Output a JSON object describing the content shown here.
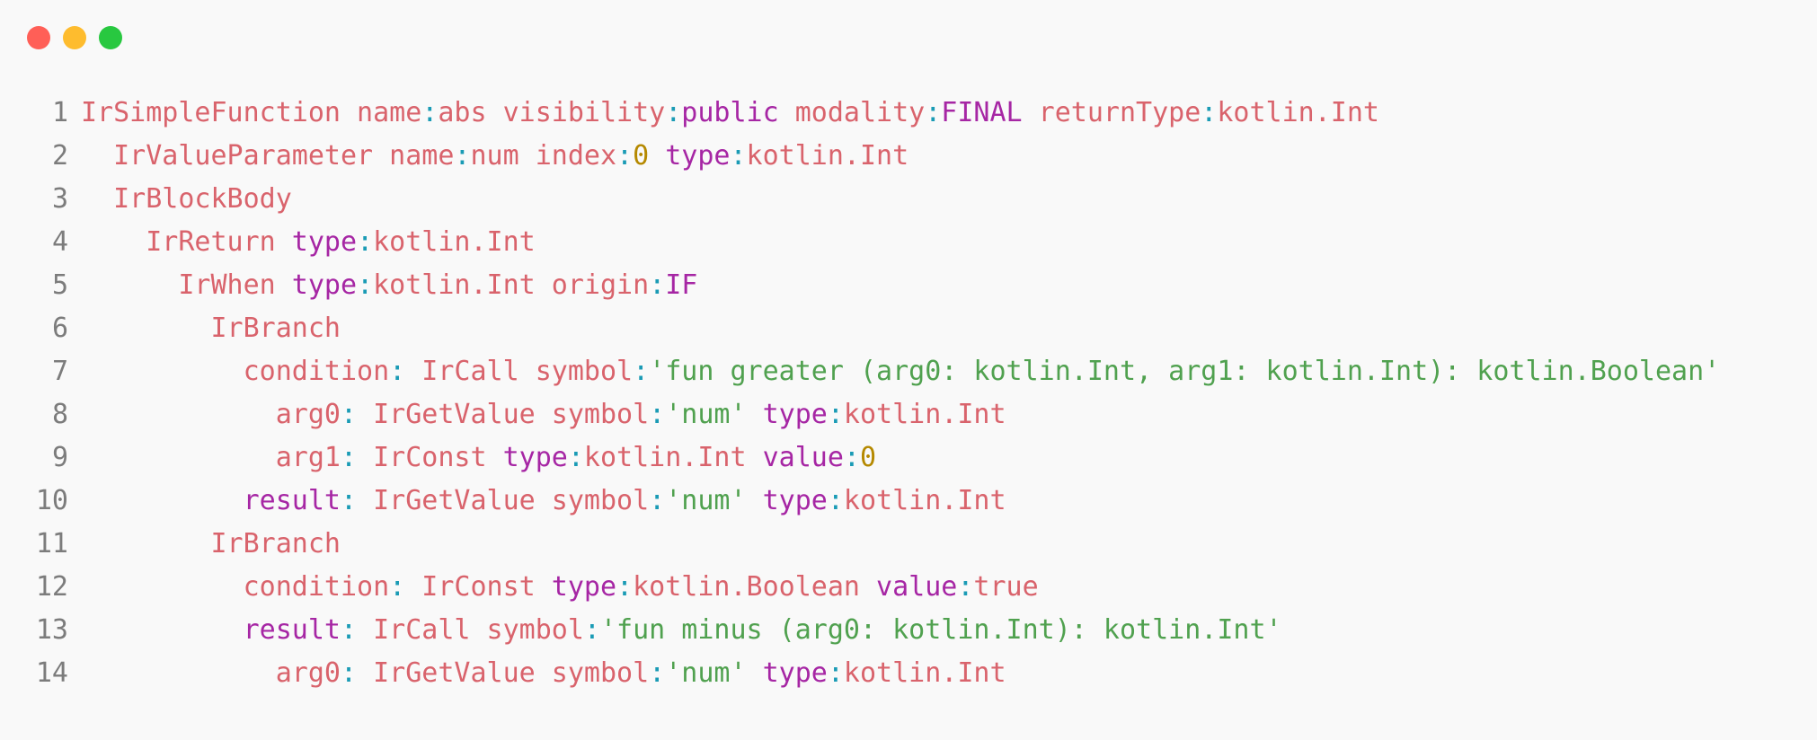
{
  "window": {
    "controls": [
      {
        "name": "close",
        "color": "#ff5f57"
      },
      {
        "name": "minimize",
        "color": "#febc2e"
      },
      {
        "name": "zoom",
        "color": "#28c840"
      }
    ]
  },
  "colors": {
    "node": "#d9636c",
    "key": "#d9636c",
    "colon": "#1a9bb5",
    "keyword": "#a626a4",
    "string": "#50a14f",
    "number": "#b58900",
    "text": "#d9636c",
    "lineno": "#7c7c7c"
  },
  "lines": [
    {
      "n": "1",
      "tokens": [
        {
          "t": "IrSimpleFunction",
          "c": "node"
        },
        {
          "t": " name",
          "c": "key"
        },
        {
          "t": ":",
          "c": "colon"
        },
        {
          "t": "abs",
          "c": "node"
        },
        {
          "t": " visibility",
          "c": "key"
        },
        {
          "t": ":",
          "c": "colon"
        },
        {
          "t": "public",
          "c": "keyword"
        },
        {
          "t": " modality",
          "c": "key"
        },
        {
          "t": ":",
          "c": "colon"
        },
        {
          "t": "FINAL",
          "c": "keyword"
        },
        {
          "t": " returnType",
          "c": "key"
        },
        {
          "t": ":",
          "c": "colon"
        },
        {
          "t": "kotlin.Int",
          "c": "node"
        }
      ]
    },
    {
      "n": "2",
      "tokens": [
        {
          "t": "  IrValueParameter",
          "c": "node"
        },
        {
          "t": " name",
          "c": "key"
        },
        {
          "t": ":",
          "c": "colon"
        },
        {
          "t": "num",
          "c": "node"
        },
        {
          "t": " index",
          "c": "key"
        },
        {
          "t": ":",
          "c": "colon"
        },
        {
          "t": "0",
          "c": "number"
        },
        {
          "t": " type",
          "c": "keyword"
        },
        {
          "t": ":",
          "c": "colon"
        },
        {
          "t": "kotlin.Int",
          "c": "node"
        }
      ]
    },
    {
      "n": "3",
      "tokens": [
        {
          "t": "  IrBlockBody",
          "c": "node"
        }
      ]
    },
    {
      "n": "4",
      "tokens": [
        {
          "t": "    IrReturn",
          "c": "node"
        },
        {
          "t": " type",
          "c": "keyword"
        },
        {
          "t": ":",
          "c": "colon"
        },
        {
          "t": "kotlin.Int",
          "c": "node"
        }
      ]
    },
    {
      "n": "5",
      "tokens": [
        {
          "t": "      IrWhen",
          "c": "node"
        },
        {
          "t": " type",
          "c": "keyword"
        },
        {
          "t": ":",
          "c": "colon"
        },
        {
          "t": "kotlin.Int",
          "c": "node"
        },
        {
          "t": " origin",
          "c": "key"
        },
        {
          "t": ":",
          "c": "colon"
        },
        {
          "t": "IF",
          "c": "keyword"
        }
      ]
    },
    {
      "n": "6",
      "tokens": [
        {
          "t": "        IrBranch",
          "c": "node"
        }
      ]
    },
    {
      "n": "7",
      "tokens": [
        {
          "t": "          condition",
          "c": "key"
        },
        {
          "t": ":",
          "c": "colon"
        },
        {
          "t": " IrCall",
          "c": "node"
        },
        {
          "t": " symbol",
          "c": "key"
        },
        {
          "t": ":",
          "c": "colon"
        },
        {
          "t": "'fun greater (arg0: kotlin.Int, arg1: kotlin.Int): kotlin.Boolean'",
          "c": "string"
        }
      ]
    },
    {
      "n": "8",
      "tokens": [
        {
          "t": "            arg0",
          "c": "key"
        },
        {
          "t": ":",
          "c": "colon"
        },
        {
          "t": " IrGetValue",
          "c": "node"
        },
        {
          "t": " symbol",
          "c": "key"
        },
        {
          "t": ":",
          "c": "colon"
        },
        {
          "t": "'num'",
          "c": "string"
        },
        {
          "t": " type",
          "c": "keyword"
        },
        {
          "t": ":",
          "c": "colon"
        },
        {
          "t": "kotlin.Int",
          "c": "node"
        }
      ]
    },
    {
      "n": "9",
      "tokens": [
        {
          "t": "            arg1",
          "c": "key"
        },
        {
          "t": ":",
          "c": "colon"
        },
        {
          "t": " IrConst",
          "c": "node"
        },
        {
          "t": " type",
          "c": "keyword"
        },
        {
          "t": ":",
          "c": "colon"
        },
        {
          "t": "kotlin.Int",
          "c": "node"
        },
        {
          "t": " value",
          "c": "keyword"
        },
        {
          "t": ":",
          "c": "colon"
        },
        {
          "t": "0",
          "c": "number"
        }
      ]
    },
    {
      "n": "10",
      "tokens": [
        {
          "t": "          result",
          "c": "keyword"
        },
        {
          "t": ":",
          "c": "colon"
        },
        {
          "t": " IrGetValue",
          "c": "node"
        },
        {
          "t": " symbol",
          "c": "key"
        },
        {
          "t": ":",
          "c": "colon"
        },
        {
          "t": "'num'",
          "c": "string"
        },
        {
          "t": " type",
          "c": "keyword"
        },
        {
          "t": ":",
          "c": "colon"
        },
        {
          "t": "kotlin.Int",
          "c": "node"
        }
      ]
    },
    {
      "n": "11",
      "tokens": [
        {
          "t": "        IrBranch",
          "c": "node"
        }
      ]
    },
    {
      "n": "12",
      "tokens": [
        {
          "t": "          condition",
          "c": "key"
        },
        {
          "t": ":",
          "c": "colon"
        },
        {
          "t": " IrConst",
          "c": "node"
        },
        {
          "t": " type",
          "c": "keyword"
        },
        {
          "t": ":",
          "c": "colon"
        },
        {
          "t": "kotlin.Boolean",
          "c": "node"
        },
        {
          "t": " value",
          "c": "keyword"
        },
        {
          "t": ":",
          "c": "colon"
        },
        {
          "t": "true",
          "c": "node"
        }
      ]
    },
    {
      "n": "13",
      "tokens": [
        {
          "t": "          result",
          "c": "keyword"
        },
        {
          "t": ":",
          "c": "colon"
        },
        {
          "t": " IrCall",
          "c": "node"
        },
        {
          "t": " symbol",
          "c": "key"
        },
        {
          "t": ":",
          "c": "colon"
        },
        {
          "t": "'fun minus (arg0: kotlin.Int): kotlin.Int'",
          "c": "string"
        }
      ]
    },
    {
      "n": "14",
      "tokens": [
        {
          "t": "            arg0",
          "c": "key"
        },
        {
          "t": ":",
          "c": "colon"
        },
        {
          "t": " IrGetValue",
          "c": "node"
        },
        {
          "t": " symbol",
          "c": "key"
        },
        {
          "t": ":",
          "c": "colon"
        },
        {
          "t": "'num'",
          "c": "string"
        },
        {
          "t": " type",
          "c": "keyword"
        },
        {
          "t": ":",
          "c": "colon"
        },
        {
          "t": "kotlin.Int",
          "c": "node"
        }
      ]
    }
  ]
}
